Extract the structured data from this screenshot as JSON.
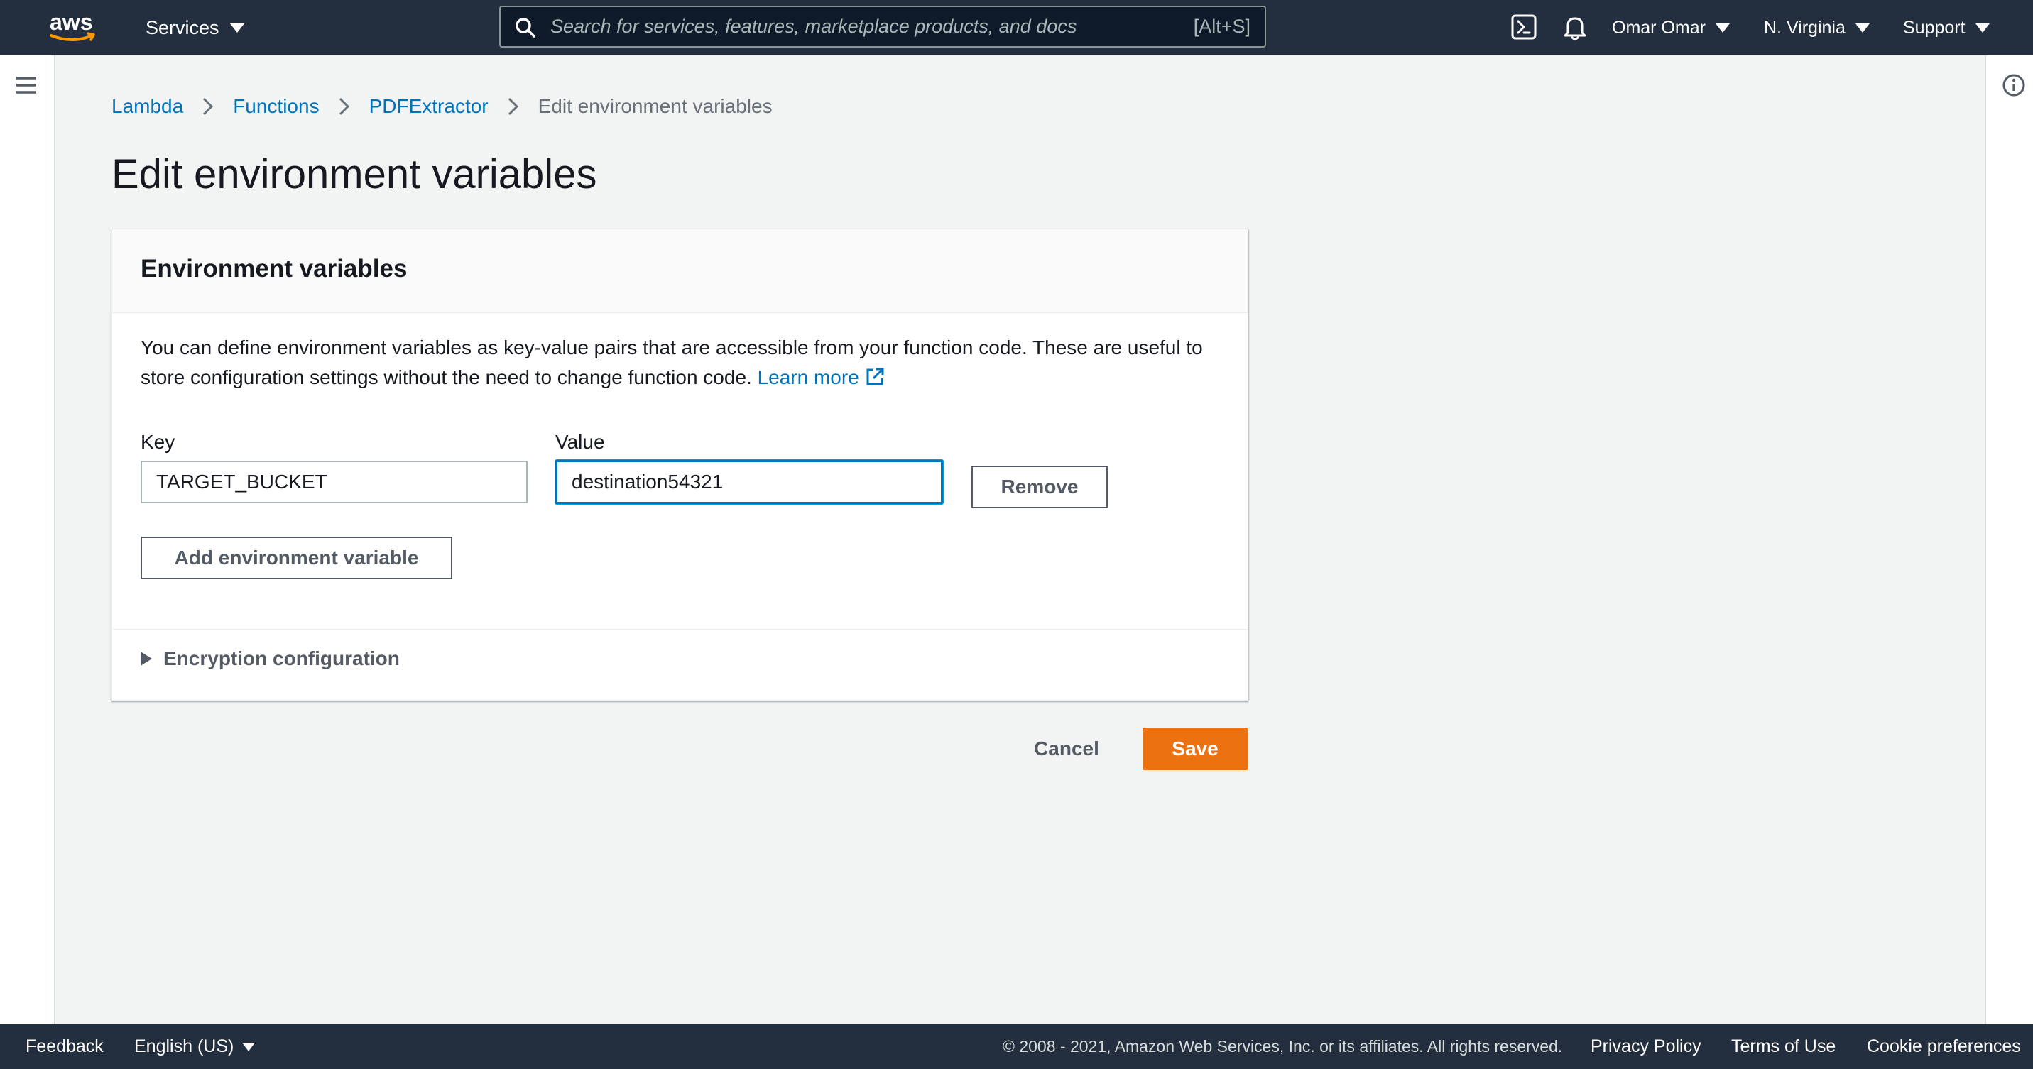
{
  "topnav": {
    "logo_text": "aws",
    "services_label": "Services",
    "search": {
      "placeholder": "Search for services, features, marketplace products, and docs",
      "shortcut": "[Alt+S]"
    },
    "icons": [
      "cloudshell-icon",
      "bell-icon"
    ],
    "user_label": "Omar Omar",
    "region_label": "N. Virginia",
    "support_label": "Support"
  },
  "breadcrumb": {
    "items": [
      "Lambda",
      "Functions",
      "PDFExtractor"
    ],
    "current": "Edit environment variables"
  },
  "page": {
    "title": "Edit environment variables"
  },
  "panel": {
    "title": "Environment variables",
    "description": "You can define environment variables as key-value pairs that are accessible from your function code. These are useful to store configuration settings without the need to change function code.",
    "learn_more": "Learn more",
    "key_label": "Key",
    "value_label": "Value",
    "variables": [
      {
        "key": "TARGET_BUCKET",
        "value": "destination54321"
      }
    ],
    "remove_label": "Remove",
    "add_label": "Add environment variable",
    "encryption_label": "Encryption configuration"
  },
  "actions": {
    "cancel_label": "Cancel",
    "save_label": "Save"
  },
  "footer": {
    "feedback": "Feedback",
    "language": "English (US)",
    "copyright": "© 2008 - 2021, Amazon Web Services, Inc. or its affiliates. All rights reserved.",
    "privacy": "Privacy Policy",
    "terms": "Terms of Use",
    "cookies": "Cookie preferences"
  },
  "colors": {
    "nav_bg": "#232f3e",
    "link": "#0073bb",
    "primary_button": "#ec7211",
    "page_bg": "#f2f3f3"
  }
}
